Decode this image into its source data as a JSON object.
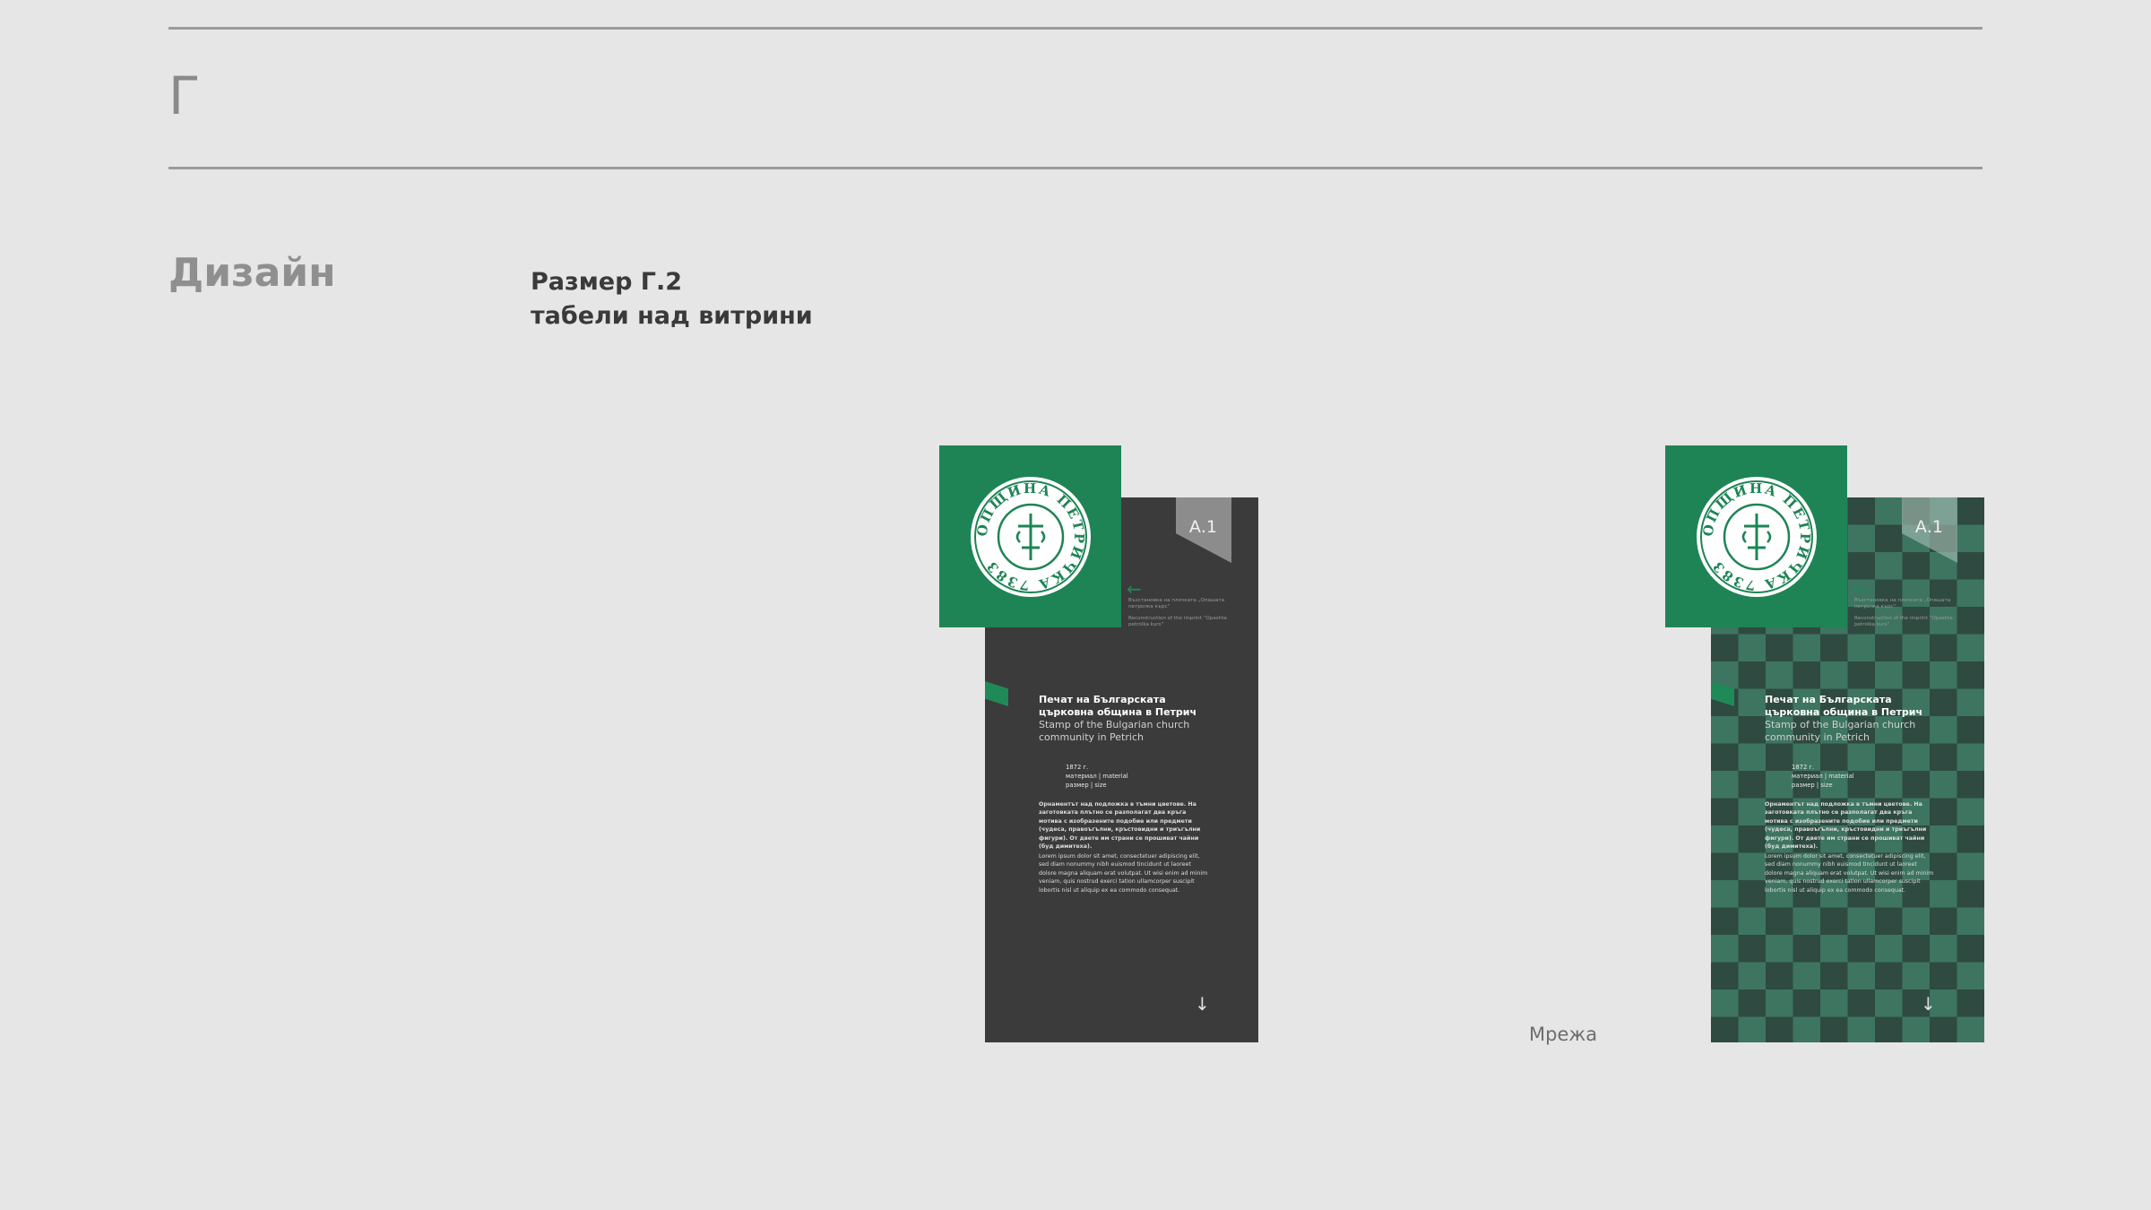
{
  "header": {
    "section_letter": "Г",
    "section_name": "Дизайн",
    "subtitle_line1": "Размер Г.2",
    "subtitle_line2": "табели над витрини"
  },
  "panels": [
    {
      "variant": "dark",
      "tab_label": "А.1",
      "recon_bg": "Възстановка на плочката „Опашата петролка кърс“",
      "recon_en": "Reconstruction of the imprint “Opashta petrolka kurs”",
      "title_bg_line1": "Печат на Българската",
      "title_bg_line2": "църковна община в Петрич",
      "title_en_line1": "Stamp of the Bulgarian church",
      "title_en_line2": "community in Petrich",
      "meta_year": "1872 г.",
      "meta_material": "материал | material",
      "meta_size": "размер | size",
      "para1": "Орнаментът над подложка в тъмни цветове. На заготовката плътно се разполагат два кръга мотива с изобразените подобие или предмети (чудеса, правоъгълни, кръстовидни и триъгълни фигури). От двете им страни се прошиват чайни (буд димитеха).",
      "para2": "Lorem ipsum dolor sit amet, consectetuer adipiscing elit, sed diam nonummy nibh euismod tincidunt ut laoreet dolore magna aliquam erat volutpat. Ut wisi enim ad minim veniam, quis nostrud exerci tation ullamcorper suscipit lobortis nisl ut aliquip ex ea commodo consequat."
    },
    {
      "variant": "grid",
      "tab_label": "А.1",
      "recon_bg": "Възстановка на плочката „Опашата петролка кърс“",
      "recon_en": "Reconstruction of the imprint “Opashta petrolka kurs”",
      "title_bg_line1": "Печат на Българската",
      "title_bg_line2": "църковна община в Петрич",
      "title_en_line1": "Stamp of the Bulgarian church",
      "title_en_line2": "community in Petrich",
      "meta_year": "1872 г.",
      "meta_material": "материал | material",
      "meta_size": "размер | size",
      "para1": "Орнаментът над подложка в тъмни цветове. На заготовката плътно се разполагат два кръга мотива с изобразените подобие или предмети (чудеса, правоъгълни, кръстовидни и триъгълни фигури). От двете им страни се прошиват чайни (буд димитеха).",
      "para2": "Lorem ipsum dolor sit amet, consectetuer adipiscing elit, sed diam nonummy nibh euismod tincidunt ut laoreet dolore magna aliquam erat volutpat. Ut wisi enim ad minim veniam, quis nostrud exerci tation ullamcorper suscipit lobortis nisl ut aliquip ex ea commodo consequat."
    }
  ],
  "seal_text": "ОПЩИНА ПЕТРИЧКА 7383",
  "grid_label": "Мрежа",
  "colors": {
    "background": "#e6e6e6",
    "rule": "#9b9b9b",
    "brand_green": "#1e8455",
    "panel_dark": "#3b3b3b",
    "grid_light": "#3d7561",
    "grid_dark": "#2f4a40"
  },
  "icons": {
    "arrow_left": "←",
    "arrow_down": "↓"
  }
}
